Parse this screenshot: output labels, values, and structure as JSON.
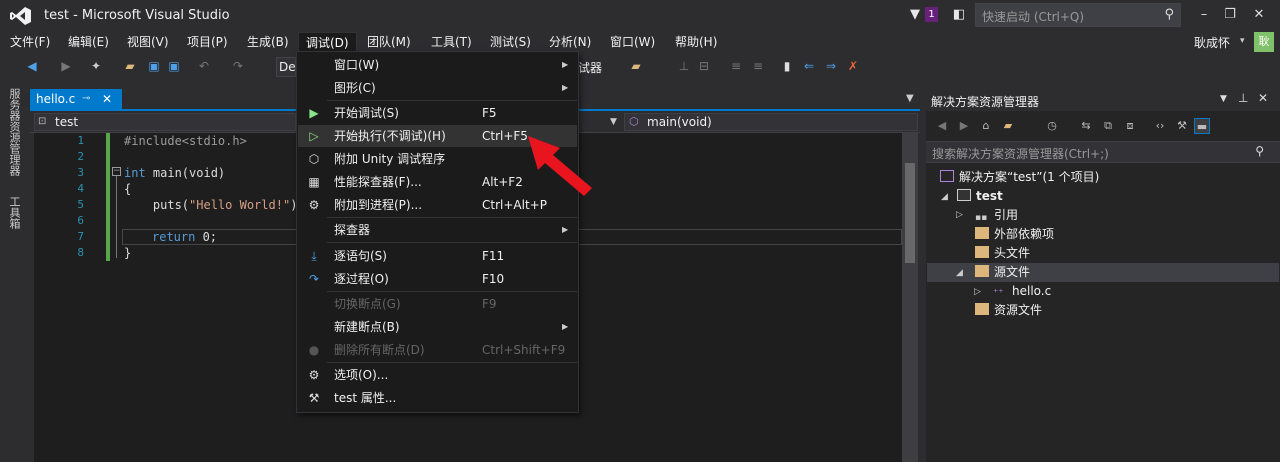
{
  "window": {
    "title": "test - Microsoft Visual Studio",
    "notif_count": "1"
  },
  "quick_launch": {
    "placeholder": "快速启动 (Ctrl+Q)"
  },
  "user": {
    "name": "耿成怀",
    "avatar_text": "耿"
  },
  "menubar": [
    "文件(F)",
    "编辑(E)",
    "视图(V)",
    "项目(P)",
    "生成(B)",
    "调试(D)",
    "团队(M)",
    "工具(T)",
    "测试(S)",
    "分析(N)",
    "窗口(W)",
    "帮助(H)"
  ],
  "toolbar": {
    "config_combo": "De",
    "debug_target": "试器"
  },
  "side_tabs": [
    "服务器资源管理器",
    "工具箱"
  ],
  "editor": {
    "tab_title": "hello.c",
    "nav_scope": "test",
    "nav_member": "main(void)",
    "line_numbers": [
      "1",
      "2",
      "3",
      "4",
      "5",
      "6",
      "7",
      "8"
    ],
    "lines": {
      "l1": "#include<stdio.h>",
      "l3_kw": "int",
      "l3_rest": " main(void)",
      "l4": "{",
      "l5_a": "    puts(",
      "l5_str": "\"Hello World!\"",
      "l5_b": ");",
      "l7_kw": "return",
      "l7_rest": " 0;",
      "l8": "}"
    }
  },
  "debug_menu": {
    "items": [
      {
        "label": "窗口(W)",
        "shortcut": "",
        "submenu": true,
        "disabled": false,
        "icon": ""
      },
      {
        "label": "图形(C)",
        "shortcut": "",
        "submenu": true,
        "disabled": false,
        "icon": ""
      },
      {
        "label": "开始调试(S)",
        "shortcut": "F5",
        "submenu": false,
        "disabled": false,
        "icon": "play-icon"
      },
      {
        "label": "开始执行(不调试)(H)",
        "shortcut": "Ctrl+F5",
        "submenu": false,
        "disabled": false,
        "icon": "play-outline-icon"
      },
      {
        "label": "附加 Unity 调试程序",
        "shortcut": "",
        "submenu": false,
        "disabled": false,
        "icon": "unity-icon"
      },
      {
        "label": "性能探查器(F)...",
        "shortcut": "Alt+F2",
        "submenu": false,
        "disabled": false,
        "icon": "profiler-icon"
      },
      {
        "label": "附加到进程(P)...",
        "shortcut": "Ctrl+Alt+P",
        "submenu": false,
        "disabled": false,
        "icon": "attach-icon"
      },
      {
        "label": "探查器",
        "shortcut": "",
        "submenu": true,
        "disabled": false,
        "icon": ""
      },
      {
        "label": "逐语句(S)",
        "shortcut": "F11",
        "submenu": false,
        "disabled": false,
        "icon": "step-into-icon"
      },
      {
        "label": "逐过程(O)",
        "shortcut": "F10",
        "submenu": false,
        "disabled": false,
        "icon": "step-over-icon"
      },
      {
        "label": "切换断点(G)",
        "shortcut": "F9",
        "submenu": false,
        "disabled": true,
        "icon": ""
      },
      {
        "label": "新建断点(B)",
        "shortcut": "",
        "submenu": true,
        "disabled": false,
        "icon": ""
      },
      {
        "label": "删除所有断点(D)",
        "shortcut": "Ctrl+Shift+F9",
        "submenu": false,
        "disabled": true,
        "icon": "delete-breakpoints-icon"
      },
      {
        "label": "选项(O)...",
        "shortcut": "",
        "submenu": false,
        "disabled": false,
        "icon": "gear-icon"
      },
      {
        "label": "test 属性...",
        "shortcut": "",
        "submenu": false,
        "disabled": false,
        "icon": "wrench-icon"
      }
    ]
  },
  "solution_explorer": {
    "title": "解决方案资源管理器",
    "search_placeholder": "搜索解决方案资源管理器(Ctrl+;)",
    "tree": {
      "solution": "解决方案“test”(1 个项目)",
      "project": "test",
      "references": "引用",
      "external": "外部依赖项",
      "headers": "头文件",
      "sources": "源文件",
      "hello": "hello.c",
      "resources": "资源文件"
    }
  },
  "colors": {
    "accent": "#007acc",
    "annotation_arrow": "#e8141e",
    "menu_bg": "#1b1b1c"
  }
}
